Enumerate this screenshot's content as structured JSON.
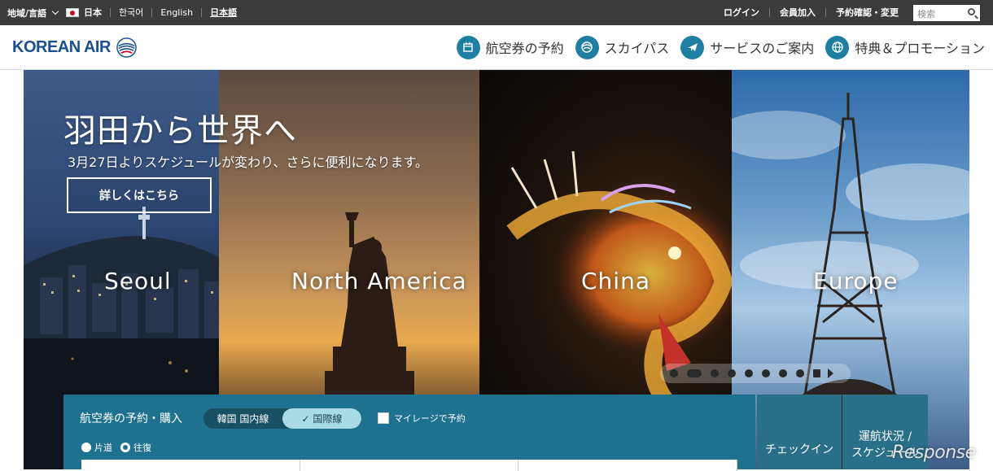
{
  "topbar": {
    "region_label": "地域/言語",
    "country": "日本",
    "languages": [
      "한국어",
      "English",
      "日本語"
    ],
    "links": [
      "ログイン",
      "会員加入",
      "予約確認・変更"
    ],
    "search_placeholder": "検索"
  },
  "header": {
    "logo_text": "KOREAN AIR",
    "nav": [
      "航空券の予約",
      "スカイパス",
      "サービスのご案内",
      "特典＆プロモーション"
    ]
  },
  "hero": {
    "title": "羽田から世界へ",
    "subtitle": "3月27日よりスケジュールが変わり、さらに便利になります。",
    "button": "詳しくはこちら",
    "destinations": [
      "Seoul",
      "North America",
      "China",
      "Europe"
    ],
    "slide_count": 9,
    "active_slide": 1
  },
  "booking": {
    "title": "航空券の予約・購入",
    "segment": [
      "韓国 国内線",
      "国際線"
    ],
    "segment_selected": "国際線",
    "mileage_label": "マイレージで予約",
    "trip_types": [
      "片道",
      "往復"
    ],
    "trip_selected": "往復"
  },
  "side": {
    "checkin": "チェックイン",
    "status_line1": "運航状況 /",
    "status_line2": "スケジュール"
  },
  "watermark": "Response",
  "colors": {
    "topbar": "#3b3b3b",
    "brand_blue": "#1b4f8f",
    "booking_teal": "#1e7290",
    "nav_icon": "#1f7fa3"
  }
}
